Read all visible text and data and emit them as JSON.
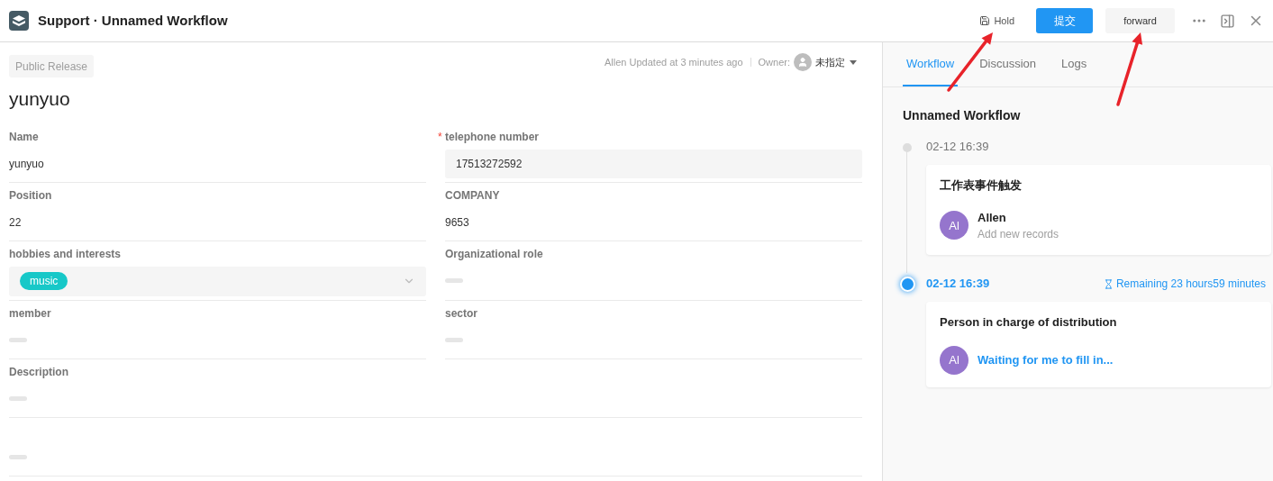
{
  "header": {
    "title": "Support · Unnamed Workflow",
    "actions": [
      {
        "kind": "hold",
        "label": "Hold"
      },
      {
        "kind": "primary",
        "label": "提交"
      },
      {
        "kind": "secondary",
        "label": "forward"
      }
    ]
  },
  "record": {
    "status_tag": "Public Release",
    "updated": "Allen Updated at 3 minutes ago",
    "owner_label": "Owner:",
    "owner_value": "未指定",
    "title": "yunyuo",
    "fields": [
      {
        "label": "Name",
        "kind": "text",
        "value": "yunyuo"
      },
      {
        "label": "telephone number",
        "required_mark": "*",
        "kind": "input",
        "value": "17513272592"
      },
      {
        "label": "Position",
        "kind": "text",
        "value": "22"
      },
      {
        "label": "COMPANY",
        "kind": "text",
        "value": "9653"
      },
      {
        "label": "hobbies and interests",
        "kind": "select",
        "tags": [
          {
            "label": "music",
            "color": "#17c8c8"
          }
        ]
      },
      {
        "label": "Organizational role",
        "kind": "empty"
      },
      {
        "label": "member",
        "kind": "empty"
      },
      {
        "label": "sector",
        "kind": "empty"
      },
      {
        "label": "Description",
        "kind": "empty",
        "wide": true
      },
      {
        "kind": "empty",
        "wide": true
      }
    ]
  },
  "panel": {
    "tabs": [
      {
        "label": "Workflow",
        "selected": true
      },
      {
        "label": "Discussion",
        "selected": false
      },
      {
        "label": "Logs",
        "selected": false
      }
    ],
    "title": "Unnamed Workflow",
    "steps": [
      {
        "time": "02-12 16:39",
        "current": false,
        "card_title": "工作表事件触发",
        "avatar": "Al",
        "person": "Allen",
        "note": "Add new records"
      },
      {
        "time": "02-12 16:39",
        "current": true,
        "remaining": "Remaining 23 hours59 minutes",
        "card_title": "Person in charge of distribution",
        "avatar": "Al",
        "status": "Waiting for me to fill in..."
      }
    ]
  }
}
